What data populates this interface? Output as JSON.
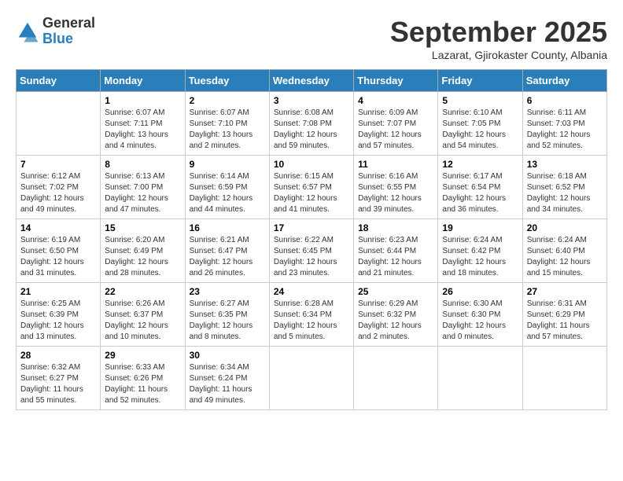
{
  "logo": {
    "general": "General",
    "blue": "Blue"
  },
  "header": {
    "month": "September 2025",
    "location": "Lazarat, Gjirokaster County, Albania"
  },
  "days_of_week": [
    "Sunday",
    "Monday",
    "Tuesday",
    "Wednesday",
    "Thursday",
    "Friday",
    "Saturday"
  ],
  "weeks": [
    [
      {
        "day": "",
        "sunrise": "",
        "sunset": "",
        "daylight": ""
      },
      {
        "day": "1",
        "sunrise": "Sunrise: 6:07 AM",
        "sunset": "Sunset: 7:11 PM",
        "daylight": "Daylight: 13 hours and 4 minutes."
      },
      {
        "day": "2",
        "sunrise": "Sunrise: 6:07 AM",
        "sunset": "Sunset: 7:10 PM",
        "daylight": "Daylight: 13 hours and 2 minutes."
      },
      {
        "day": "3",
        "sunrise": "Sunrise: 6:08 AM",
        "sunset": "Sunset: 7:08 PM",
        "daylight": "Daylight: 12 hours and 59 minutes."
      },
      {
        "day": "4",
        "sunrise": "Sunrise: 6:09 AM",
        "sunset": "Sunset: 7:07 PM",
        "daylight": "Daylight: 12 hours and 57 minutes."
      },
      {
        "day": "5",
        "sunrise": "Sunrise: 6:10 AM",
        "sunset": "Sunset: 7:05 PM",
        "daylight": "Daylight: 12 hours and 54 minutes."
      },
      {
        "day": "6",
        "sunrise": "Sunrise: 6:11 AM",
        "sunset": "Sunset: 7:03 PM",
        "daylight": "Daylight: 12 hours and 52 minutes."
      }
    ],
    [
      {
        "day": "7",
        "sunrise": "Sunrise: 6:12 AM",
        "sunset": "Sunset: 7:02 PM",
        "daylight": "Daylight: 12 hours and 49 minutes."
      },
      {
        "day": "8",
        "sunrise": "Sunrise: 6:13 AM",
        "sunset": "Sunset: 7:00 PM",
        "daylight": "Daylight: 12 hours and 47 minutes."
      },
      {
        "day": "9",
        "sunrise": "Sunrise: 6:14 AM",
        "sunset": "Sunset: 6:59 PM",
        "daylight": "Daylight: 12 hours and 44 minutes."
      },
      {
        "day": "10",
        "sunrise": "Sunrise: 6:15 AM",
        "sunset": "Sunset: 6:57 PM",
        "daylight": "Daylight: 12 hours and 41 minutes."
      },
      {
        "day": "11",
        "sunrise": "Sunrise: 6:16 AM",
        "sunset": "Sunset: 6:55 PM",
        "daylight": "Daylight: 12 hours and 39 minutes."
      },
      {
        "day": "12",
        "sunrise": "Sunrise: 6:17 AM",
        "sunset": "Sunset: 6:54 PM",
        "daylight": "Daylight: 12 hours and 36 minutes."
      },
      {
        "day": "13",
        "sunrise": "Sunrise: 6:18 AM",
        "sunset": "Sunset: 6:52 PM",
        "daylight": "Daylight: 12 hours and 34 minutes."
      }
    ],
    [
      {
        "day": "14",
        "sunrise": "Sunrise: 6:19 AM",
        "sunset": "Sunset: 6:50 PM",
        "daylight": "Daylight: 12 hours and 31 minutes."
      },
      {
        "day": "15",
        "sunrise": "Sunrise: 6:20 AM",
        "sunset": "Sunset: 6:49 PM",
        "daylight": "Daylight: 12 hours and 28 minutes."
      },
      {
        "day": "16",
        "sunrise": "Sunrise: 6:21 AM",
        "sunset": "Sunset: 6:47 PM",
        "daylight": "Daylight: 12 hours and 26 minutes."
      },
      {
        "day": "17",
        "sunrise": "Sunrise: 6:22 AM",
        "sunset": "Sunset: 6:45 PM",
        "daylight": "Daylight: 12 hours and 23 minutes."
      },
      {
        "day": "18",
        "sunrise": "Sunrise: 6:23 AM",
        "sunset": "Sunset: 6:44 PM",
        "daylight": "Daylight: 12 hours and 21 minutes."
      },
      {
        "day": "19",
        "sunrise": "Sunrise: 6:24 AM",
        "sunset": "Sunset: 6:42 PM",
        "daylight": "Daylight: 12 hours and 18 minutes."
      },
      {
        "day": "20",
        "sunrise": "Sunrise: 6:24 AM",
        "sunset": "Sunset: 6:40 PM",
        "daylight": "Daylight: 12 hours and 15 minutes."
      }
    ],
    [
      {
        "day": "21",
        "sunrise": "Sunrise: 6:25 AM",
        "sunset": "Sunset: 6:39 PM",
        "daylight": "Daylight: 12 hours and 13 minutes."
      },
      {
        "day": "22",
        "sunrise": "Sunrise: 6:26 AM",
        "sunset": "Sunset: 6:37 PM",
        "daylight": "Daylight: 12 hours and 10 minutes."
      },
      {
        "day": "23",
        "sunrise": "Sunrise: 6:27 AM",
        "sunset": "Sunset: 6:35 PM",
        "daylight": "Daylight: 12 hours and 8 minutes."
      },
      {
        "day": "24",
        "sunrise": "Sunrise: 6:28 AM",
        "sunset": "Sunset: 6:34 PM",
        "daylight": "Daylight: 12 hours and 5 minutes."
      },
      {
        "day": "25",
        "sunrise": "Sunrise: 6:29 AM",
        "sunset": "Sunset: 6:32 PM",
        "daylight": "Daylight: 12 hours and 2 minutes."
      },
      {
        "day": "26",
        "sunrise": "Sunrise: 6:30 AM",
        "sunset": "Sunset: 6:30 PM",
        "daylight": "Daylight: 12 hours and 0 minutes."
      },
      {
        "day": "27",
        "sunrise": "Sunrise: 6:31 AM",
        "sunset": "Sunset: 6:29 PM",
        "daylight": "Daylight: 11 hours and 57 minutes."
      }
    ],
    [
      {
        "day": "28",
        "sunrise": "Sunrise: 6:32 AM",
        "sunset": "Sunset: 6:27 PM",
        "daylight": "Daylight: 11 hours and 55 minutes."
      },
      {
        "day": "29",
        "sunrise": "Sunrise: 6:33 AM",
        "sunset": "Sunset: 6:26 PM",
        "daylight": "Daylight: 11 hours and 52 minutes."
      },
      {
        "day": "30",
        "sunrise": "Sunrise: 6:34 AM",
        "sunset": "Sunset: 6:24 PM",
        "daylight": "Daylight: 11 hours and 49 minutes."
      },
      {
        "day": "",
        "sunrise": "",
        "sunset": "",
        "daylight": ""
      },
      {
        "day": "",
        "sunrise": "",
        "sunset": "",
        "daylight": ""
      },
      {
        "day": "",
        "sunrise": "",
        "sunset": "",
        "daylight": ""
      },
      {
        "day": "",
        "sunrise": "",
        "sunset": "",
        "daylight": ""
      }
    ]
  ]
}
